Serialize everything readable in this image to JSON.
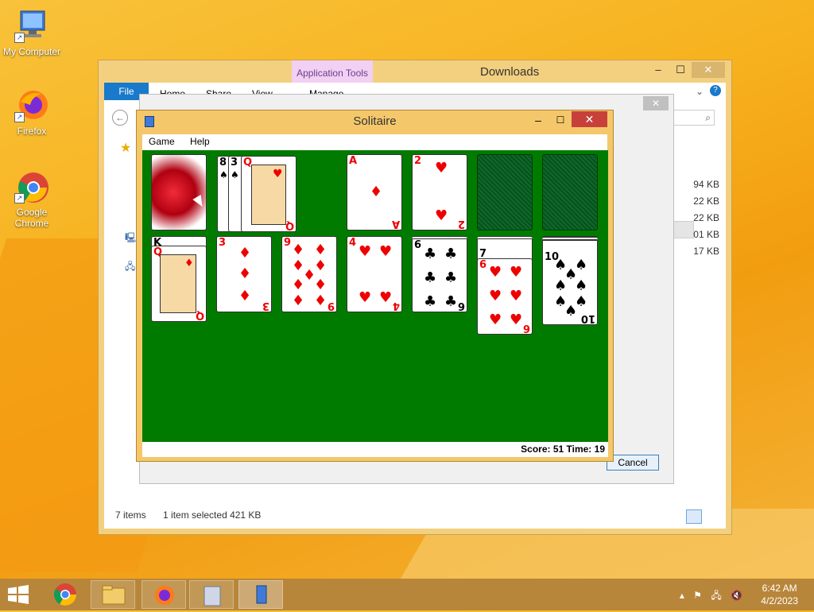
{
  "desktop": {
    "icons": [
      {
        "label": "My Computer"
      },
      {
        "label": "Firefox"
      },
      {
        "label": "Google Chrome"
      }
    ]
  },
  "explorer": {
    "title": "Downloads",
    "ribbon_tabs": {
      "file": "File",
      "home": "Home",
      "share": "Share",
      "view": "View",
      "manage": "Manage",
      "app_tools": "Application Tools"
    },
    "file_sizes": [
      "94 KB",
      "22 KB",
      "22 KB",
      "01 KB",
      "17 KB"
    ],
    "status": {
      "items": "7 items",
      "selected": "1 item selected  421 KB"
    }
  },
  "dialog": {
    "cancel_label": "Cancel"
  },
  "solitaire": {
    "title": "Solitaire",
    "menu": {
      "game": "Game",
      "help": "Help"
    },
    "status": "Score: 51  Time: 19",
    "waste": [
      "8",
      "3",
      "Q"
    ],
    "foundations": [
      {
        "rank": "A",
        "suit": "♦"
      },
      {
        "rank": "2",
        "suit": "♥"
      }
    ],
    "tableau_tops": [
      {
        "rank": "Q",
        "suit": "♦",
        "under": "K"
      },
      {
        "rank": "3",
        "suit": "♦"
      },
      {
        "rank": "9",
        "suit": "♦"
      },
      {
        "rank": "4",
        "suit": "♥"
      },
      {
        "rank": "6",
        "suit": "♣"
      },
      {
        "rank": "6",
        "suit": "♥",
        "under": "7"
      },
      {
        "rank": "10",
        "suit": "♠"
      }
    ]
  },
  "taskbar": {
    "time": "6:42 AM",
    "date": "4/2/2023"
  },
  "colors": {
    "felt": "#007b00",
    "close_red": "#c7413a",
    "window_frame": "#f4c86a",
    "file_tab": "#1979ca"
  }
}
